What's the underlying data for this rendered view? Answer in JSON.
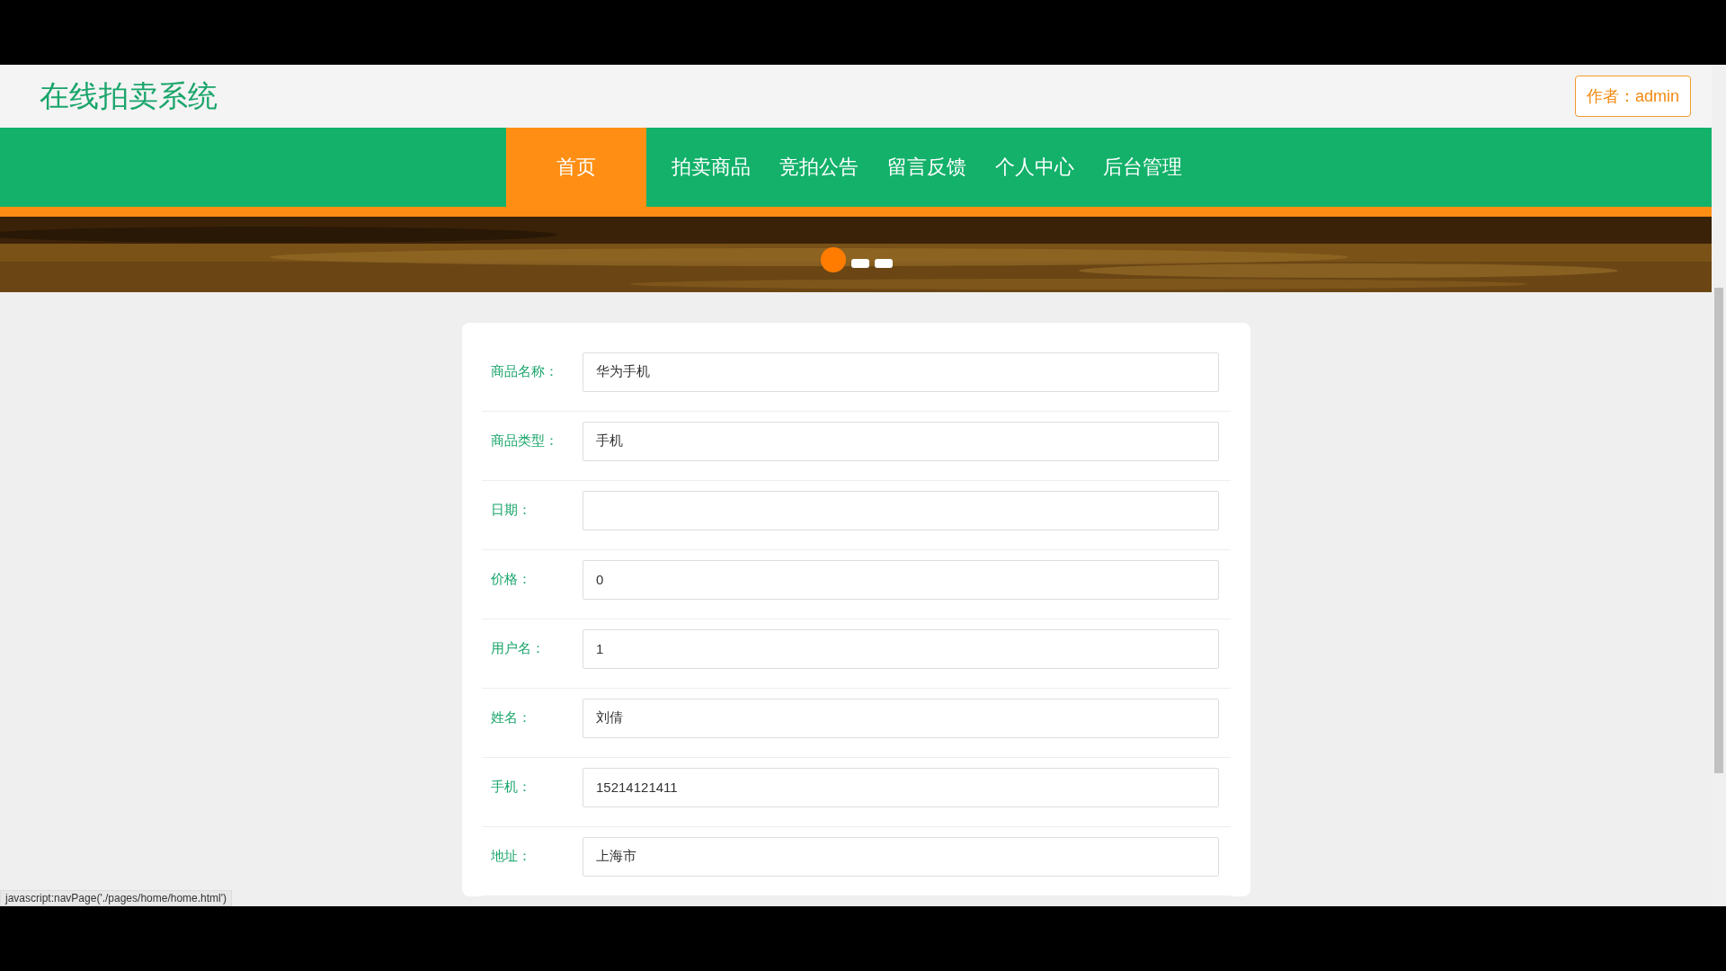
{
  "header": {
    "title": "在线拍卖系统",
    "author_button": "作者：admin"
  },
  "nav": [
    {
      "label": "首页",
      "selected": true
    },
    {
      "label": "拍卖商品",
      "selected": false
    },
    {
      "label": "竞拍公告",
      "selected": false
    },
    {
      "label": "留言反馈",
      "selected": false
    },
    {
      "label": "个人中心",
      "selected": false
    },
    {
      "label": "后台管理",
      "selected": false
    }
  ],
  "banner": {
    "dots": [
      {
        "selected": true
      },
      {
        "selected": false
      },
      {
        "selected": false
      }
    ]
  },
  "form": [
    {
      "label": "商品名称：",
      "value": "华为手机"
    },
    {
      "label": "商品类型：",
      "value": "手机"
    },
    {
      "label": "日期："
    },
    {
      "label": "价格：",
      "value": "0"
    },
    {
      "label": "用户名：",
      "value": "1"
    },
    {
      "label": "姓名：",
      "value": "刘倩"
    },
    {
      "label": "手机：",
      "value": "15214121411"
    },
    {
      "label": "地址：",
      "value": "上海市"
    }
  ],
  "status_bar": "javascript:navPage('./pages/home/home.html')"
}
